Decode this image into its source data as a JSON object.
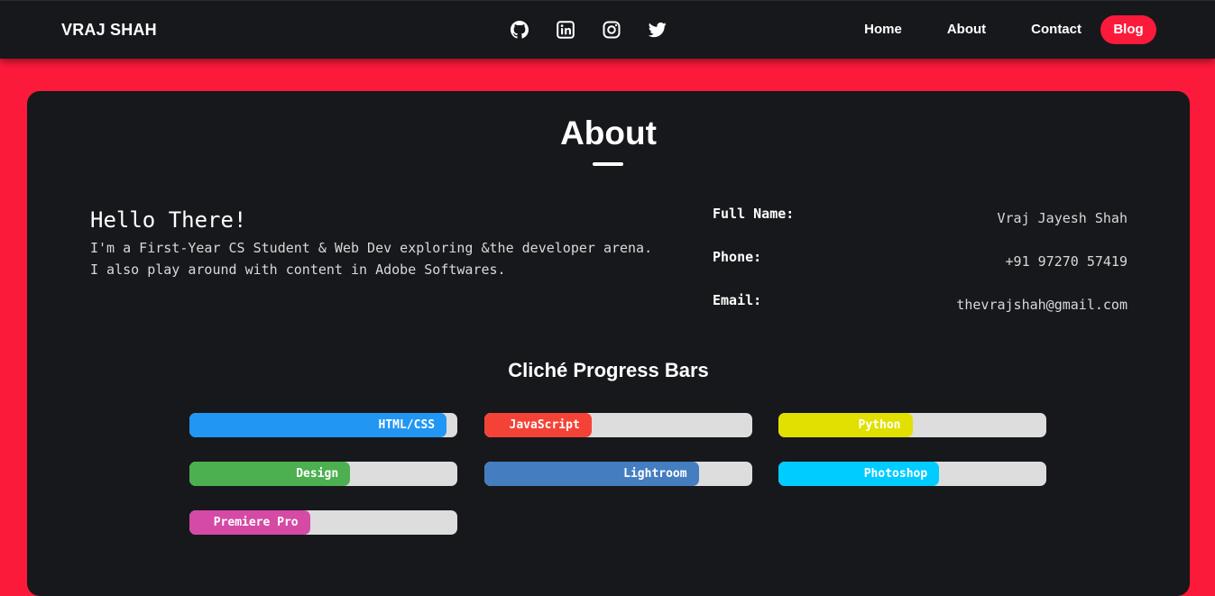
{
  "navbar": {
    "brand": "VRAJ SHAH",
    "socials": [
      {
        "icon": "github-icon"
      },
      {
        "icon": "linkedin-icon"
      },
      {
        "icon": "instagram-icon"
      },
      {
        "icon": "twitter-icon"
      }
    ],
    "links": [
      "Home",
      "About",
      "Contact",
      "Blog"
    ]
  },
  "about": {
    "title": "About",
    "greeting": "Hello There!",
    "intro": "I'm a First-Year CS Student & Web Dev exploring &the developer arena. I also play around with content in Adobe Softwares.",
    "info": [
      {
        "label": "Full Name:",
        "value": "Vraj Jayesh Shah"
      },
      {
        "label": "Phone:",
        "value": "+91 97270 57419"
      },
      {
        "label": "Email:",
        "value": "thevrajshah@gmail.com"
      }
    ]
  },
  "skills": {
    "title": "Cliché Progress Bars",
    "bars": [
      {
        "label": "HTML/CSS",
        "percent": 96,
        "color": "#2196f3"
      },
      {
        "label": "JavaScript",
        "percent": 40,
        "color": "#f44336"
      },
      {
        "label": "Python",
        "percent": 50,
        "color": "#e2e000"
      },
      {
        "label": "Design",
        "percent": 60,
        "color": "#4caf50"
      },
      {
        "label": "Lightroom",
        "percent": 80,
        "color": "#447ec0"
      },
      {
        "label": "Photoshop",
        "percent": 60,
        "color": "#00ccff"
      },
      {
        "label": "Premiere Pro",
        "percent": 45,
        "color": "#d44aa5"
      }
    ]
  },
  "colors": {
    "accent": "#fc1a3b",
    "background": "#17181c"
  }
}
